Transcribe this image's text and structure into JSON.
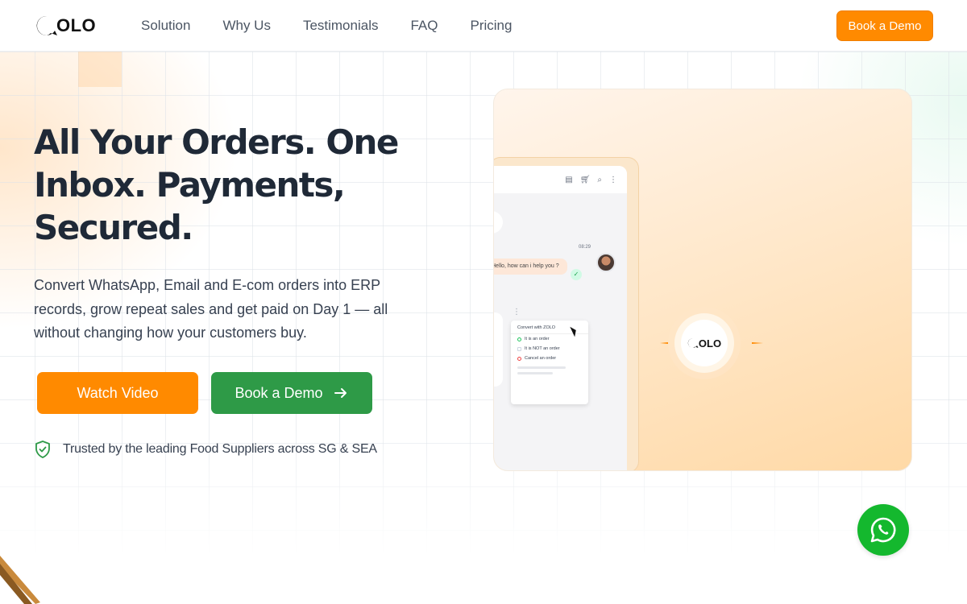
{
  "brand": {
    "logo_text": "OLO",
    "accent": "#ff8a00",
    "green": "#2e9a47"
  },
  "nav": {
    "items": [
      {
        "label": "Solution"
      },
      {
        "label": "Why Us"
      },
      {
        "label": "Testimonials"
      },
      {
        "label": "FAQ"
      },
      {
        "label": "Pricing"
      }
    ],
    "cta_label": "Book a Demo"
  },
  "hero": {
    "title": "All Your Orders. One Inbox. Payments, Secured.",
    "subtitle": "Convert WhatsApp, Email and E-com orders into ERP records, grow repeat sales and get paid on Day 1 — all without changing how your customers buy.",
    "watch_label": "Watch Video",
    "demo_label": "Book a Demo",
    "trust_text": "Trusted by the leading Food Suppliers across SG & SEA"
  },
  "illustration": {
    "chat_time": "08:29",
    "chat_message": "Hello, how can i help you ?",
    "menu_title": "Convert with ZOLO",
    "menu_items": [
      "It is an order",
      "It is NOT an order",
      "Cancel an order"
    ],
    "center_logo": "OLO"
  },
  "icons": {
    "shield": "shield-check-icon",
    "arrow": "arrow-right-icon",
    "whatsapp": "whatsapp-icon"
  }
}
